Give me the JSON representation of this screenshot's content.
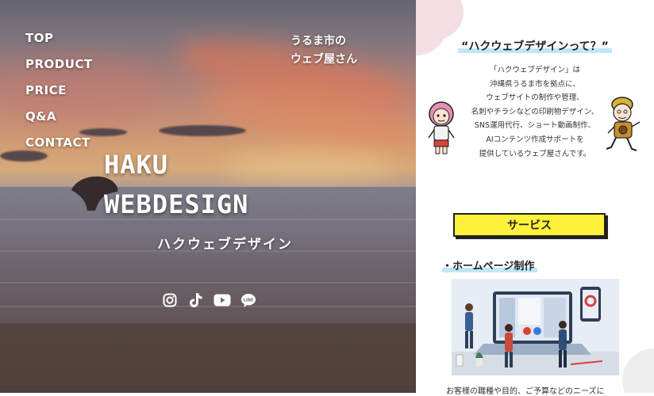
{
  "nav": {
    "items": [
      {
        "label": "TOP"
      },
      {
        "label": "PRODUCT"
      },
      {
        "label": "PRICE"
      },
      {
        "label": "Q&A"
      },
      {
        "label": "CONTACT"
      }
    ]
  },
  "hero": {
    "tagline": "うるま市の\nウェブ屋さん",
    "brand_line1": "HAKU",
    "brand_line2": "WEBDESIGN",
    "brand_kana": "ハクウェブデザイン",
    "social_icons": [
      "instagram-icon",
      "tiktok-icon",
      "youtube-icon",
      "line-icon"
    ],
    "line_icon_text": "LINE"
  },
  "about": {
    "title": "“ハクウェブデザインって？”",
    "body": "「ハクウェブデザイン」は\n沖縄県うるま市を拠点に、\nウェブサイトの制作や管理、\n名刺やチラシなどの印刷物デザイン、\nSNS運用代行、ショート動画制作、\nAIコンテンツ作成サポートを\n提供しているウェブ屋さんです。"
  },
  "services": {
    "button_label": "サービス",
    "homepage_title": "・ホームページ制作",
    "bottom_text": "お客様の職種や目的、ご予算などのニーズに"
  },
  "colors": {
    "accent_yellow": "#fff23a",
    "highlight_blue": "#bfe7f7",
    "blob_pink": "#f6dfe3"
  }
}
